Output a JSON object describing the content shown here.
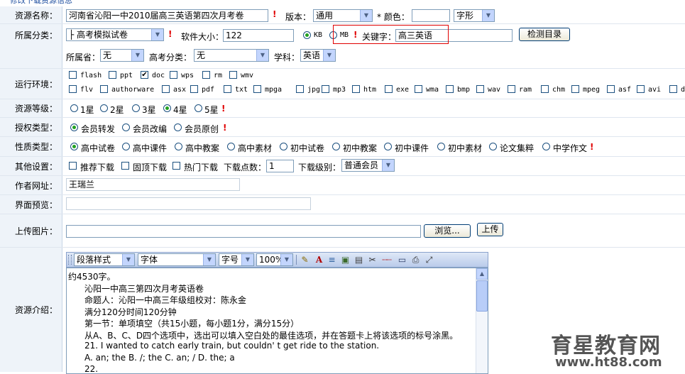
{
  "header_fragment": "修改下载资源信息",
  "labels": {
    "name": "资源名称：",
    "category": "所属分类：",
    "env": "运行环境：",
    "level": "资源等级：",
    "auth": "授权类型：",
    "nature": "性质类型：",
    "other": "其他设置：",
    "author": "作者网址：",
    "preview": "界面预览：",
    "upload": "上传图片：",
    "intro": "资源介绍："
  },
  "name_row": {
    "title_value": "河南省沁阳一中2010届高三英语第四次月考卷",
    "version_label": "版本：",
    "version_value": "通用",
    "color_label": "* 颜色：",
    "color_value": "",
    "font_value": "字形"
  },
  "category_row": {
    "category_value": "├ 高考模拟试卷",
    "size_label": "软件大小：",
    "size_value": "122",
    "kb_label": "KB",
    "mb_label": "MB",
    "keyword_label": "关键字：",
    "keyword_value": "高三英语",
    "check_button": "检测目录"
  },
  "region_row": {
    "province_label": "所属省：",
    "province_value": "无",
    "gaokao_label": "高考分类：",
    "gaokao_value": "无",
    "subject_label": "学科：",
    "subject_value": "英语"
  },
  "env_options_row1": [
    "flash",
    "ppt",
    "doc",
    "wps",
    "rm",
    "wmv"
  ],
  "env_options_row2": [
    "flv",
    "authorware",
    "asx",
    "pdf",
    "txt",
    "mpga",
    "jpg",
    "mp3",
    "htm",
    "exe",
    "wma",
    "bmp",
    "wav",
    "ram",
    "chm",
    "mpeg",
    "asf",
    "avi",
    "d"
  ],
  "levels": [
    "1星",
    "2星",
    "3星",
    "4星",
    "5星"
  ],
  "auth_types": [
    "会员转发",
    "会员改编",
    "会员原创"
  ],
  "nature_types": [
    "高中试卷",
    "高中课件",
    "高中教案",
    "高中素材",
    "初中试卷",
    "初中教案",
    "初中课件",
    "初中素材",
    "论文集粹",
    "中学作文"
  ],
  "other_row": {
    "recommend": "推荐下载",
    "pin": "固顶下载",
    "hot": "热门下载",
    "points_label": "下载点数：",
    "points_value": "1",
    "level_label": "下载级别：",
    "level_value": "普通会员"
  },
  "author_value": "王瑞兰",
  "preview_value": "",
  "upload_row": {
    "path_value": "",
    "browse_button": "浏览...",
    "upload_button": "上传"
  },
  "editor": {
    "paragraph_style": "段落样式",
    "font": "字体",
    "font_size": "字号",
    "zoom": "100%",
    "lines": [
      "约4530字。",
      "沁阳一中高三第四次月考英语卷",
      "命题人：沁阳一中高三年级组校对：陈永金",
      "满分120分时间120分钟",
      "第一节：单项填空（共15小题，每小题1分，满分15分）",
      "从A、B、C、D四个选项中，选出可以填入空白处的最佳选项，并在答题卡上将该选项的标号涂黑。",
      "21. I wanted to catch     early train, but couldn' t get     ride to the station.",
      "A. an; the      B. /; the       C. an; /       D. the; a",
      "22."
    ]
  },
  "watermark": {
    "brand": "育星教育网",
    "url": "www.ht88.com"
  },
  "colors": {
    "label_bg": "#eef3f9",
    "required": "#e00000",
    "highlight_box": "#e00000",
    "watermark_red": "#d8242c",
    "watermark_gray": "#555555"
  }
}
